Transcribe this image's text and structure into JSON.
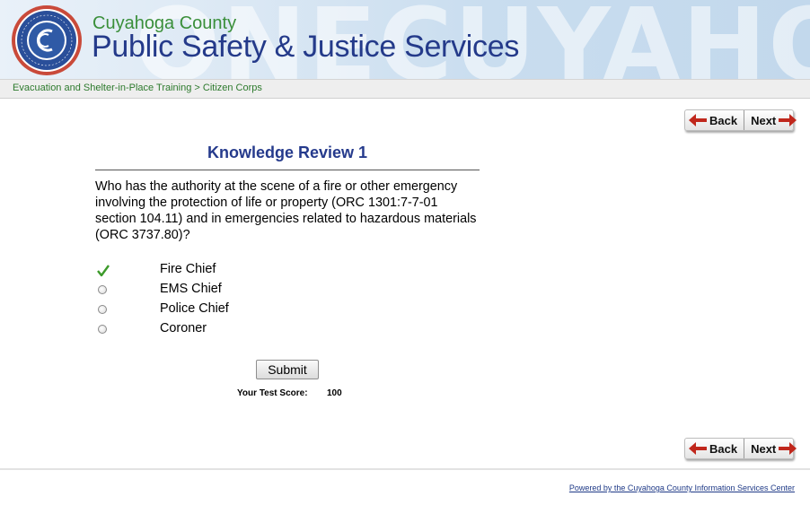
{
  "header": {
    "background_word": "ONECUYAHOGA",
    "county": "Cuyahoga County",
    "agency": "Public Safety & Justice Services",
    "seal_alt": "Cuyahoga County seal"
  },
  "breadcrumb": {
    "text": "Evacuation and Shelter-in-Place Training > Citizen Corps"
  },
  "nav": {
    "back_label": "Back",
    "next_label": "Next"
  },
  "quiz": {
    "title": "Knowledge Review 1",
    "question": "Who has the authority at the scene of a fire or other emergency involving the protection of life or property (ORC 1301:7-7-01 section 104.11) and in emergencies related to hazardous materials (ORC 3737.80)?",
    "options": [
      {
        "label": "Fire Chief",
        "state": "correct-check"
      },
      {
        "label": "EMS Chief",
        "state": "radio"
      },
      {
        "label": "Police Chief",
        "state": "radio"
      },
      {
        "label": "Coroner",
        "state": "radio"
      }
    ],
    "submit_label": "Submit",
    "score_label": "Your Test Score:",
    "score_value": "100"
  },
  "footer": {
    "powered_by": "Powered by the Cuyahoga County Information Services Center"
  },
  "colors": {
    "title_blue": "#253a8c",
    "county_green": "#3a8f3a",
    "arrow_red": "#c0271c",
    "check_green": "#3c9a2a"
  }
}
